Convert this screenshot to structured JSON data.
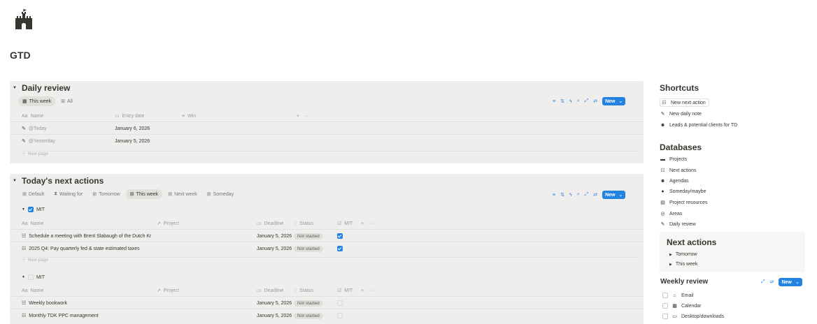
{
  "page": {
    "title": "GTD",
    "icon": "castle-icon"
  },
  "daily_review": {
    "title": "Daily review",
    "views": [
      {
        "icon": "calendar-icon",
        "label": "This week",
        "active": true
      },
      {
        "icon": "table-icon",
        "label": "All",
        "active": false
      }
    ],
    "new_label": "New",
    "columns": {
      "name": "Name",
      "entry_date": "Entry date",
      "win": "Win"
    },
    "rows": [
      {
        "name": "@Today",
        "date": "January 6, 2026"
      },
      {
        "name": "@Yesterday",
        "date": "January 5, 2026"
      }
    ],
    "new_page": "New page"
  },
  "next_actions": {
    "title": "Today's next actions",
    "views": [
      {
        "icon": "table-icon",
        "label": "Default",
        "active": false
      },
      {
        "icon": "hourglass-icon",
        "label": "Waiting for",
        "active": false
      },
      {
        "icon": "table-icon",
        "label": "Tomorrow",
        "active": false
      },
      {
        "icon": "table-icon",
        "label": "This week",
        "active": true
      },
      {
        "icon": "table-icon",
        "label": "Next week",
        "active": false
      },
      {
        "icon": "table-icon",
        "label": "Someday",
        "active": false
      }
    ],
    "new_label": "New",
    "columns": {
      "name": "Name",
      "project": "Project",
      "deadline": "Deadline",
      "status": "Status",
      "mit": "MIT"
    },
    "group_mit": {
      "label": "MIT",
      "rows": [
        {
          "name": "Schedule a meeting with Brent Slabaugh of the Dutch Kr",
          "deadline": "January 5, 2026",
          "status": "Not started"
        },
        {
          "name": "2025 Q4: Pay quarterly fed & state estimated taxes",
          "deadline": "January 5, 2026",
          "status": "Not started"
        }
      ],
      "new_page": "New page"
    },
    "group_not_mit": {
      "label": "MIT",
      "rows": [
        {
          "name": "Weekly bookwork",
          "deadline": "January 5, 2026",
          "status": "Not started"
        },
        {
          "name": "Monthly TDK PPC management",
          "deadline": "January 5, 2026",
          "status": "Not started"
        }
      ]
    }
  },
  "sidebar": {
    "shortcuts_title": "Shortcuts",
    "shortcuts": [
      {
        "icon": "checklist-icon",
        "label": "New next action"
      },
      {
        "icon": "pencil-lines-icon",
        "label": "New daily note"
      },
      {
        "icon": "people-icon",
        "label": "Leads & potential clients for TD"
      }
    ],
    "databases_title": "Databases",
    "databases": [
      {
        "icon": "briefcase-icon",
        "label": "Projects"
      },
      {
        "icon": "checklist-icon",
        "label": "Next actions"
      },
      {
        "icon": "people-icon",
        "label": "Agendas"
      },
      {
        "icon": "globe-icon",
        "label": "Someday/maybe"
      },
      {
        "icon": "folder-icon",
        "label": "Project resources"
      },
      {
        "icon": "target-icon",
        "label": "Areas"
      },
      {
        "icon": "pencil-lines-icon",
        "label": "Daily review"
      }
    ],
    "next_actions_title": "Next actions",
    "next_actions_items": [
      "Tomorrow",
      "This week"
    ],
    "weekly_review_title": "Weekly review",
    "weekly_new_label": "New",
    "weekly_items": [
      {
        "icon": "inbox-icon",
        "label": "Email"
      },
      {
        "icon": "calendar-icon",
        "label": "Calendar"
      },
      {
        "icon": "monitor-icon",
        "label": "Desktop/downloads"
      }
    ]
  }
}
